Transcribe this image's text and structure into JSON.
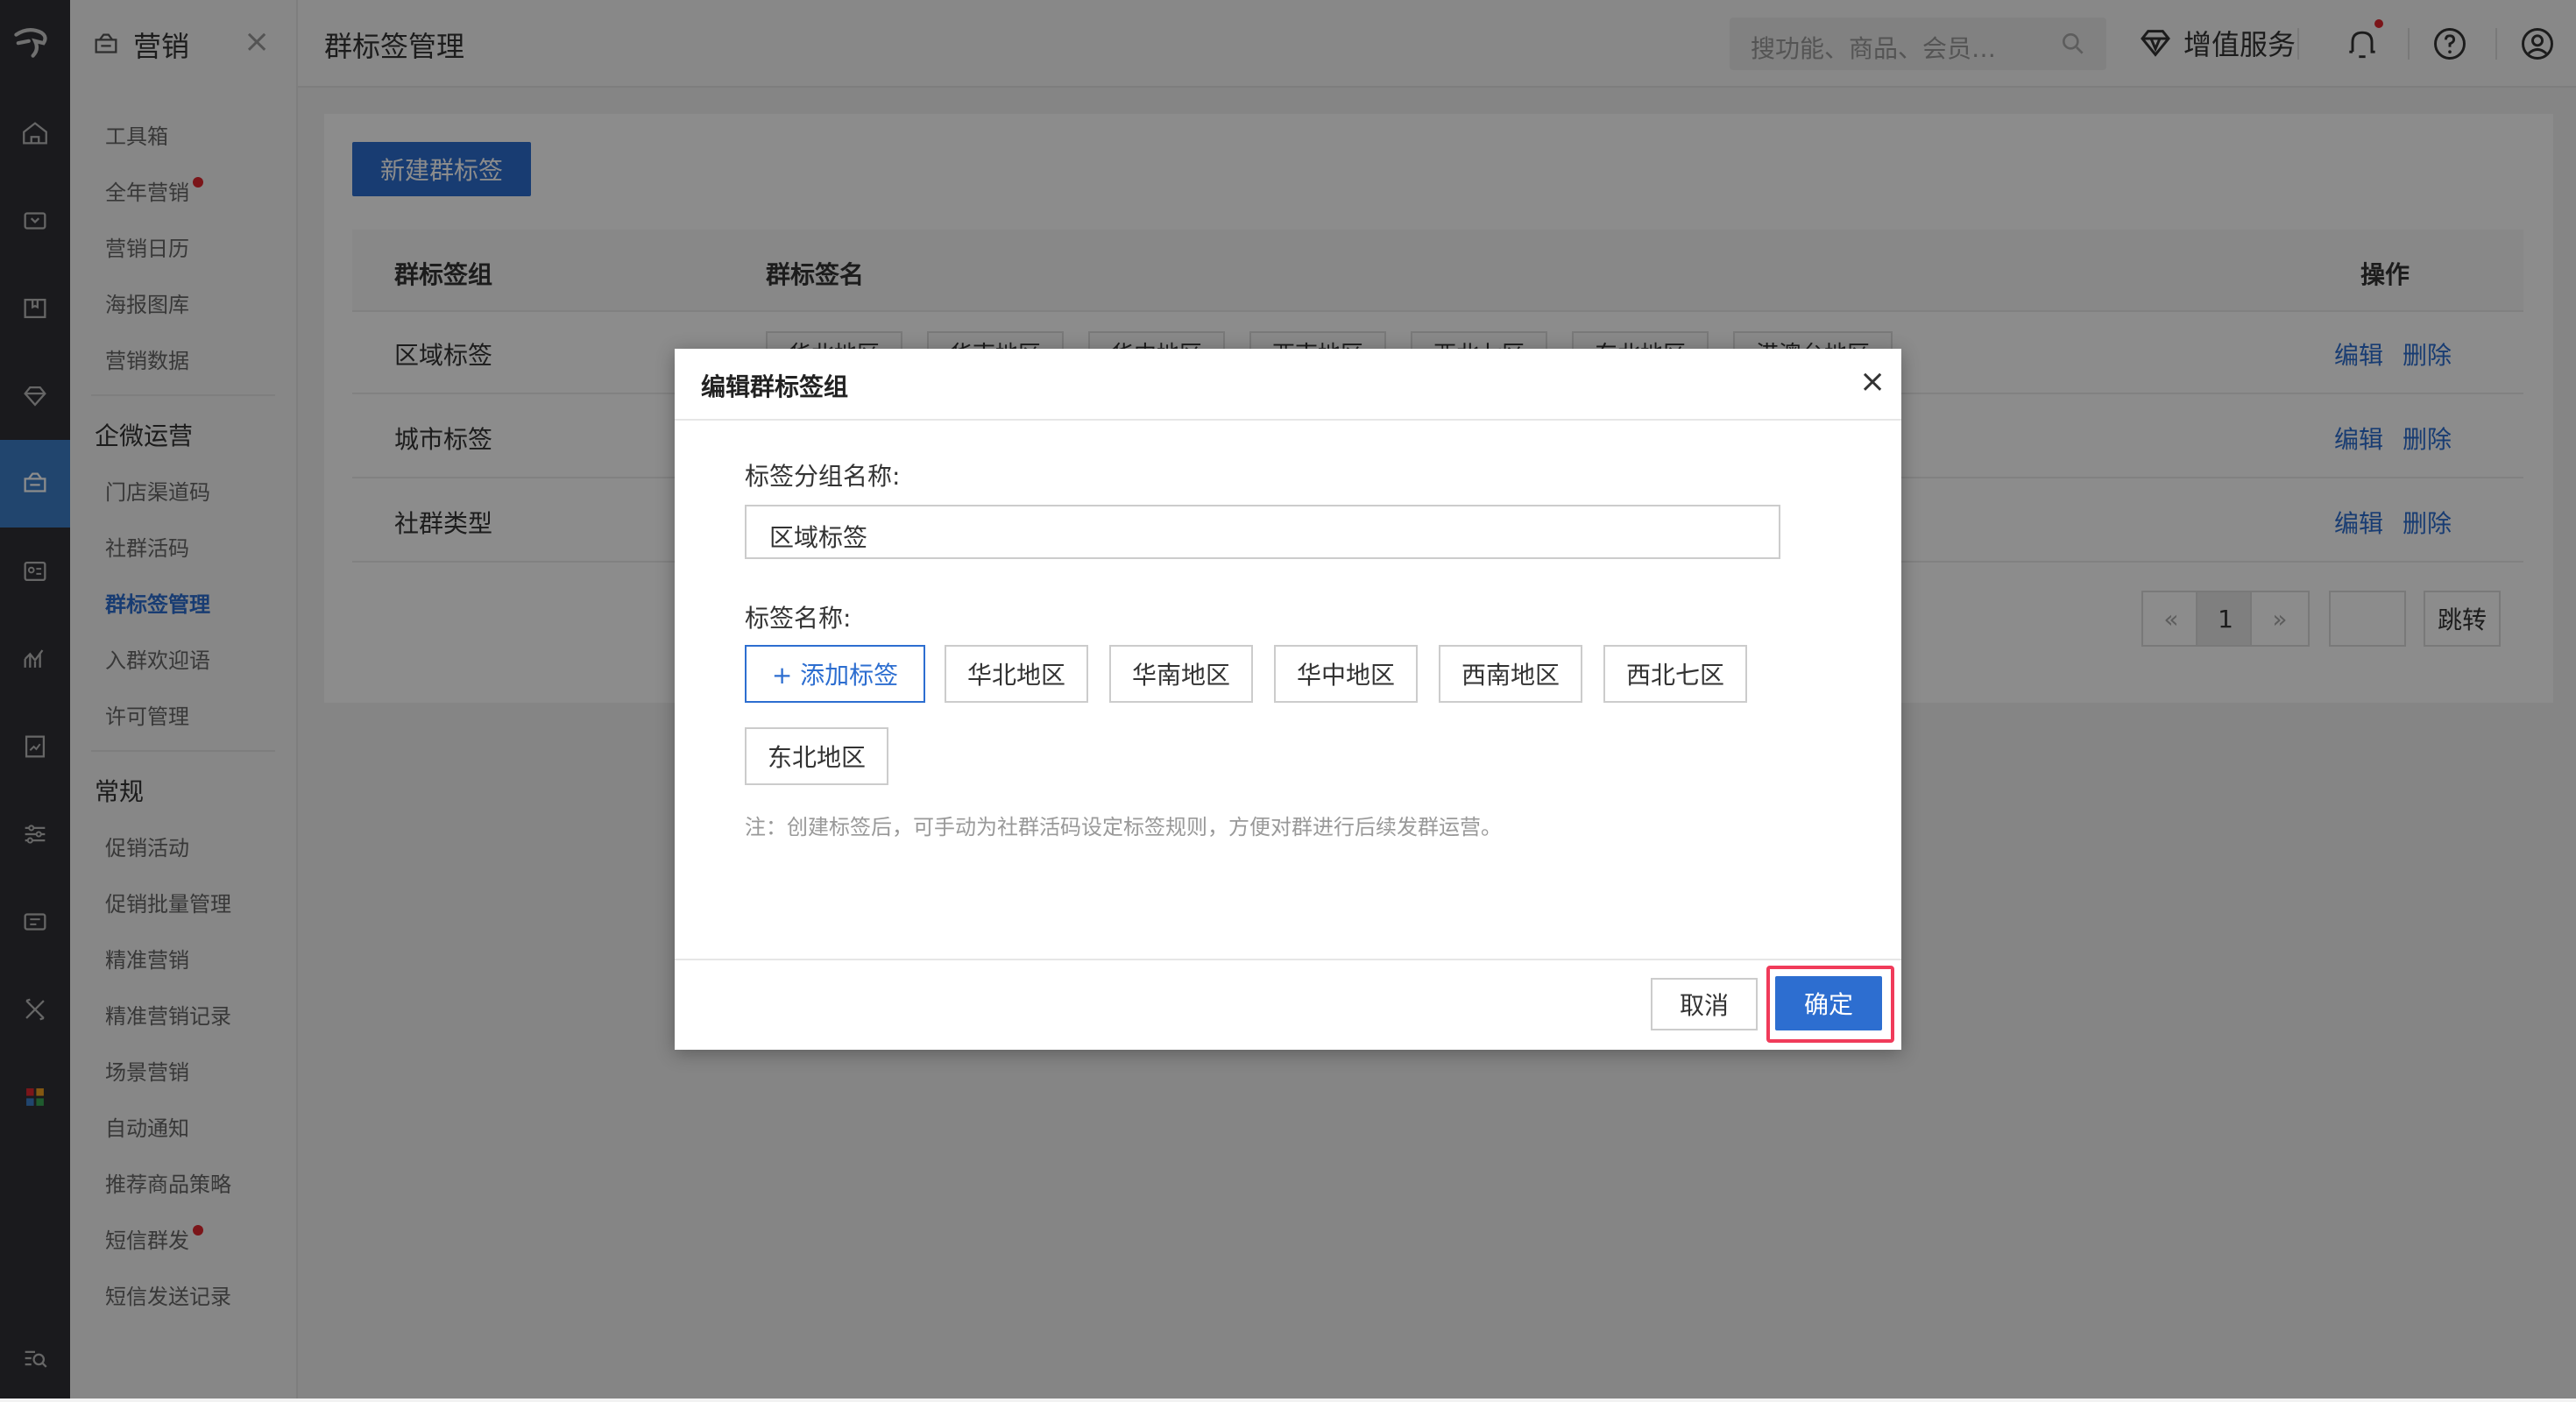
{
  "sidebar": {
    "title": "营销",
    "groups": [
      {
        "items": [
          {
            "label": "工具箱"
          },
          {
            "label": "全年营销",
            "dot": true
          },
          {
            "label": "营销日历"
          },
          {
            "label": "海报图库"
          },
          {
            "label": "营销数据"
          }
        ]
      },
      {
        "title": "企微运营",
        "items": [
          {
            "label": "门店渠道码"
          },
          {
            "label": "社群活码"
          },
          {
            "label": "群标签管理",
            "active": true
          },
          {
            "label": "入群欢迎语"
          },
          {
            "label": "许可管理"
          }
        ]
      },
      {
        "title": "常规",
        "items": [
          {
            "label": "促销活动"
          },
          {
            "label": "促销批量管理"
          },
          {
            "label": "精准营销"
          },
          {
            "label": "精准营销记录"
          },
          {
            "label": "场景营销"
          },
          {
            "label": "自动通知"
          },
          {
            "label": "推荐商品策略"
          },
          {
            "label": "短信群发",
            "dot": true
          },
          {
            "label": "短信发送记录"
          }
        ]
      }
    ]
  },
  "header": {
    "page_title": "群标签管理",
    "search_placeholder": "搜功能、商品、会员…",
    "value_added": "增值服务"
  },
  "main": {
    "new_button": "新建群标签",
    "columns": {
      "group": "群标签组",
      "name": "群标签名",
      "ops": "操作"
    },
    "rows": [
      {
        "group": "区域标签",
        "tags": [
          "华北地区",
          "华南地区",
          "华中地区",
          "西南地区",
          "西北七区",
          "东北地区",
          "港澳台地区"
        ]
      },
      {
        "group": "城市标签",
        "tags": []
      },
      {
        "group": "社群类型",
        "tags": []
      }
    ],
    "edit_label": "编辑",
    "delete_label": "删除",
    "pager": {
      "prev": "«",
      "current": "1",
      "next": "»",
      "jump": "跳转"
    }
  },
  "modal": {
    "title": "编辑群标签组",
    "close": "×",
    "group_name_label": "标签分组名称:",
    "group_name_value": "区域标签",
    "tag_name_label": "标签名称:",
    "add_tag": "+ 添加标签",
    "tags": [
      "华北地区",
      "华南地区",
      "华中地区",
      "西南地区",
      "西北七区",
      "东北地区"
    ],
    "note": "注：创建标签后，可手动为社群活码设定标签规则，方便对群进行后续发群运营。",
    "cancel": "取消",
    "confirm": "确定"
  }
}
